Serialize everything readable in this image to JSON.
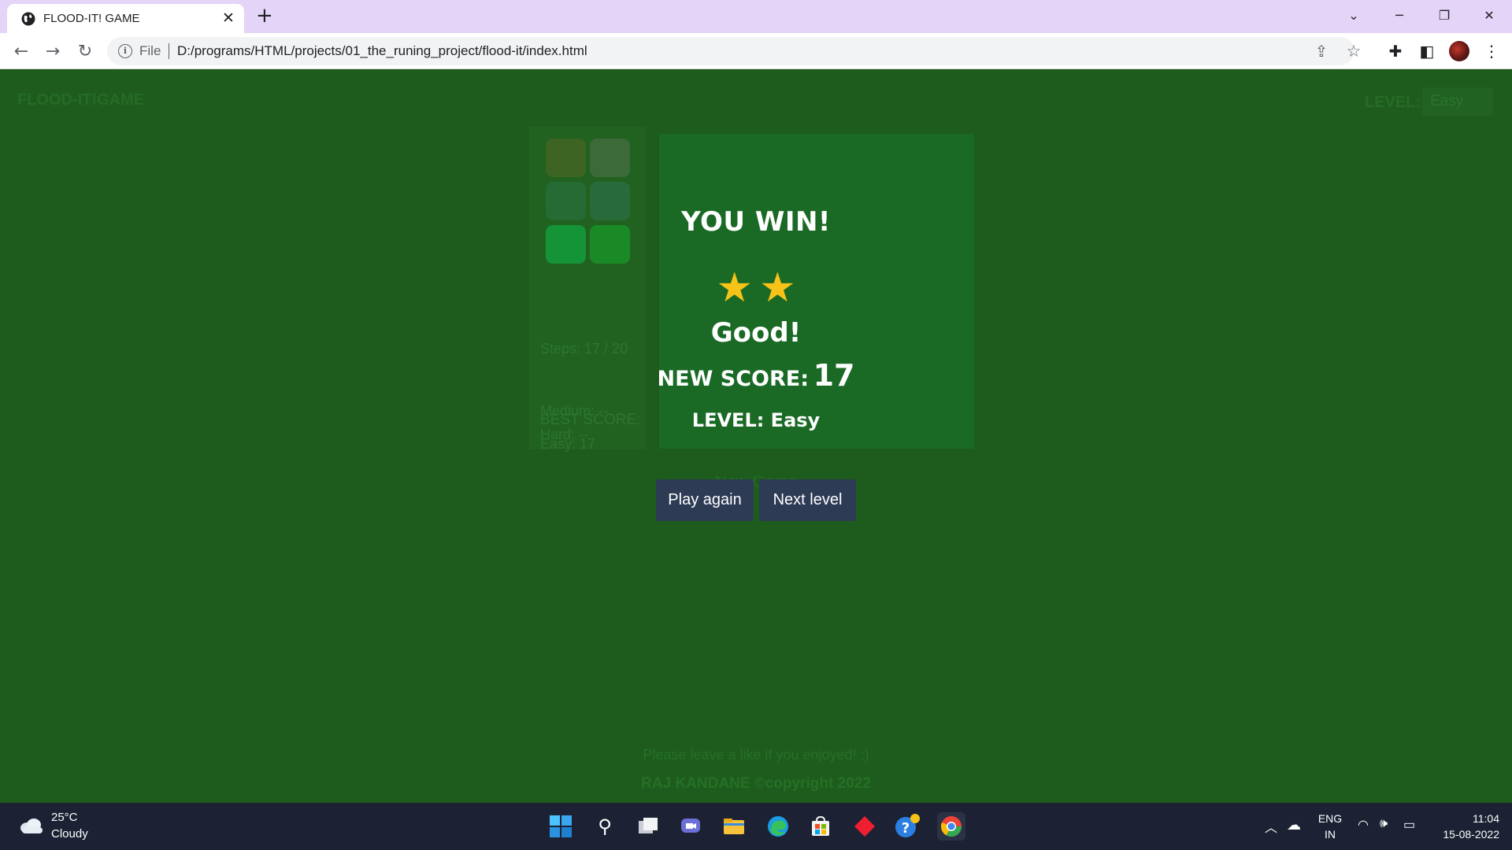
{
  "browser": {
    "tab_title": "FLOOD-IT! GAME",
    "file_label": "File",
    "url": "D:/programs/HTML/projects/01_the_runing_project/flood-it/index.html"
  },
  "page": {
    "game_title": "FLOOD-IT!GAME",
    "level_label": "LEVEL:",
    "level_value": "Easy",
    "steps": "Steps: 17 / 20",
    "best_score_title": "BEST SCORE:",
    "best_easy": "Easy: 17",
    "best_medium": "Medium: --",
    "best_hard": "Hard: --",
    "new_game": "New Game",
    "footer_note": "Please leave a like if you enjoyed! ;)",
    "footer_copy": "RAJ KANDANE ©copyright 2022",
    "swatch_colors": [
      "#3d6422",
      "#3c6a39",
      "#266a34",
      "#296a3a",
      "#149436",
      "#1a8a26"
    ]
  },
  "modal": {
    "title": "YOU WIN!",
    "stars": 2,
    "rating": "Good!",
    "score_label": "NEW SCORE:",
    "score_value": "17",
    "level_text": "LEVEL: Easy",
    "play_again": "Play again",
    "next_level": "Next level",
    "star_color": "#f7c318",
    "button_color": "#2e3b55"
  },
  "taskbar": {
    "temperature": "25°C",
    "condition": "Cloudy",
    "lang_top": "ENG",
    "lang_bottom": "IN",
    "time": "11:04",
    "date": "15-08-2022"
  }
}
